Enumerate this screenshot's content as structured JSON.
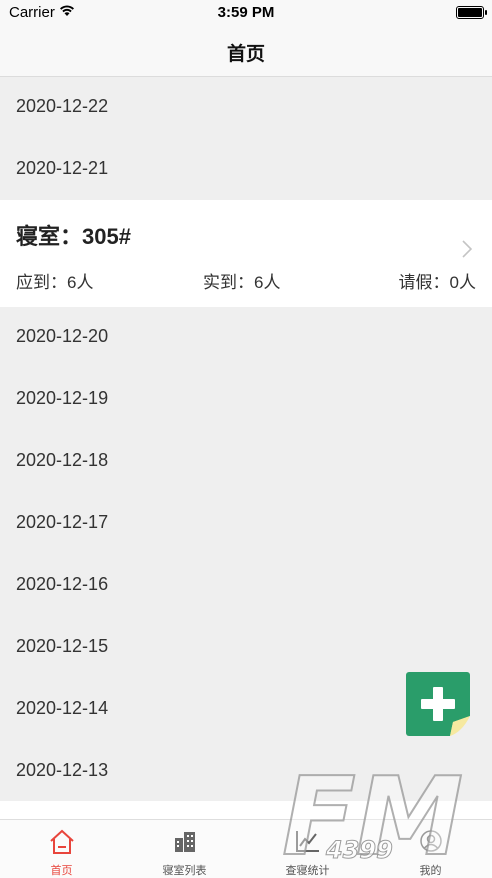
{
  "status_bar": {
    "carrier": "Carrier",
    "time": "3:59 PM"
  },
  "nav": {
    "title": "首页"
  },
  "dates_top": [
    "2020-12-22",
    "2020-12-21"
  ],
  "room_card": {
    "room_name": "寝室：305#",
    "expected": "应到：6人",
    "actual": "实到：6人",
    "leave": "请假：0人"
  },
  "dates_bottom": [
    "2020-12-20",
    "2020-12-19",
    "2020-12-18",
    "2020-12-17",
    "2020-12-16",
    "2020-12-15",
    "2020-12-14",
    "2020-12-13"
  ],
  "tabs": [
    {
      "label": "首页",
      "icon": "home-icon",
      "active": true
    },
    {
      "label": "寝室列表",
      "icon": "building-icon",
      "active": false
    },
    {
      "label": "查寝统计",
      "icon": "chart-icon",
      "active": false
    },
    {
      "label": "我的",
      "icon": "user-icon",
      "active": false
    }
  ],
  "watermark": {
    "text": "FM",
    "subtext": "4399"
  },
  "colors": {
    "accent": "#e8453c",
    "fab": "#2a9d6a",
    "background": "#efefef"
  }
}
